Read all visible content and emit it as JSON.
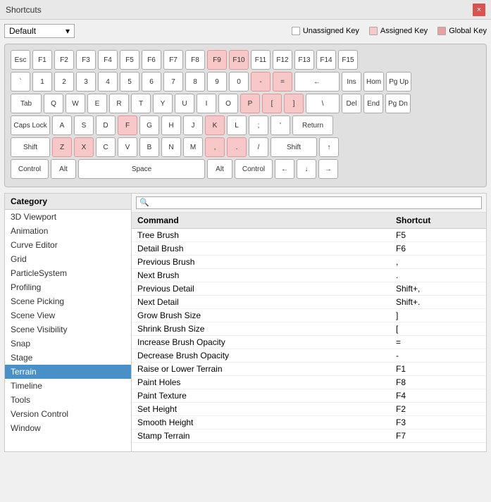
{
  "titleBar": {
    "title": "Shortcuts",
    "closeLabel": "×"
  },
  "toolbar": {
    "dropdownValue": "Default",
    "dropdownArrow": "▾",
    "legend": [
      {
        "id": "unassigned",
        "label": "Unassigned Key",
        "color": "white"
      },
      {
        "id": "assigned",
        "label": "Assigned Key",
        "color": "#f8c8c8"
      },
      {
        "id": "global",
        "label": "Global Key",
        "color": "#e8a0a0"
      }
    ]
  },
  "keyboard": {
    "rows": [
      {
        "keys": [
          {
            "label": "Esc",
            "class": "",
            "assigned": false
          },
          {
            "label": "F1",
            "class": "",
            "assigned": false
          },
          {
            "label": "F2",
            "class": "",
            "assigned": false
          },
          {
            "label": "F3",
            "class": "",
            "assigned": false
          },
          {
            "label": "F4",
            "class": "",
            "assigned": false
          },
          {
            "label": "F5",
            "class": "",
            "assigned": false
          },
          {
            "label": "F6",
            "class": "",
            "assigned": false
          },
          {
            "label": "F7",
            "class": "",
            "assigned": false
          },
          {
            "label": "F8",
            "class": "",
            "assigned": false
          },
          {
            "label": "F9",
            "class": "assigned",
            "assigned": true
          },
          {
            "label": "F10",
            "class": "assigned",
            "assigned": true
          },
          {
            "label": "F11",
            "class": "",
            "assigned": false
          },
          {
            "label": "F12",
            "class": "",
            "assigned": false
          },
          {
            "label": "F13",
            "class": "",
            "assigned": false
          },
          {
            "label": "F14",
            "class": "",
            "assigned": false
          },
          {
            "label": "F15",
            "class": "",
            "assigned": false
          }
        ]
      },
      {
        "keys": [
          {
            "label": "`",
            "class": "",
            "assigned": false
          },
          {
            "label": "1",
            "class": "",
            "assigned": false
          },
          {
            "label": "2",
            "class": "",
            "assigned": false
          },
          {
            "label": "3",
            "class": "",
            "assigned": false
          },
          {
            "label": "4",
            "class": "",
            "assigned": false
          },
          {
            "label": "5",
            "class": "",
            "assigned": false
          },
          {
            "label": "6",
            "class": "",
            "assigned": false
          },
          {
            "label": "7",
            "class": "",
            "assigned": false
          },
          {
            "label": "8",
            "class": "",
            "assigned": false
          },
          {
            "label": "9",
            "class": "",
            "assigned": false
          },
          {
            "label": "0",
            "class": "",
            "assigned": false
          },
          {
            "label": "-",
            "class": "assigned",
            "assigned": true
          },
          {
            "label": "=",
            "class": "assigned",
            "assigned": true
          },
          {
            "label": "←",
            "class": "backspace",
            "assigned": false
          },
          {
            "label": "Ins",
            "class": "",
            "assigned": false
          },
          {
            "label": "Hom",
            "class": "",
            "assigned": false
          },
          {
            "label": "Pg Up",
            "class": "",
            "assigned": false
          }
        ]
      },
      {
        "keys": [
          {
            "label": "Tab",
            "class": "tab",
            "assigned": false
          },
          {
            "label": "Q",
            "class": "",
            "assigned": false
          },
          {
            "label": "W",
            "class": "",
            "assigned": false
          },
          {
            "label": "E",
            "class": "",
            "assigned": false
          },
          {
            "label": "R",
            "class": "",
            "assigned": false
          },
          {
            "label": "T",
            "class": "",
            "assigned": false
          },
          {
            "label": "Y",
            "class": "",
            "assigned": false
          },
          {
            "label": "U",
            "class": "",
            "assigned": false
          },
          {
            "label": "I",
            "class": "",
            "assigned": false
          },
          {
            "label": "O",
            "class": "",
            "assigned": false
          },
          {
            "label": "P",
            "class": "assigned",
            "assigned": true
          },
          {
            "label": "[",
            "class": "assigned",
            "assigned": true
          },
          {
            "label": "]",
            "class": "assigned",
            "assigned": true
          },
          {
            "label": "\\",
            "class": "wide",
            "assigned": false
          },
          {
            "label": "Del",
            "class": "",
            "assigned": false
          },
          {
            "label": "End",
            "class": "",
            "assigned": false
          },
          {
            "label": "Pg Dn",
            "class": "",
            "assigned": false
          }
        ]
      },
      {
        "keys": [
          {
            "label": "Caps Lock",
            "class": "capslock",
            "assigned": false
          },
          {
            "label": "A",
            "class": "",
            "assigned": false
          },
          {
            "label": "S",
            "class": "",
            "assigned": false
          },
          {
            "label": "D",
            "class": "",
            "assigned": false
          },
          {
            "label": "F",
            "class": "assigned",
            "assigned": true
          },
          {
            "label": "G",
            "class": "",
            "assigned": false
          },
          {
            "label": "H",
            "class": "",
            "assigned": false
          },
          {
            "label": "J",
            "class": "",
            "assigned": false
          },
          {
            "label": "K",
            "class": "assigned",
            "assigned": true
          },
          {
            "label": "L",
            "class": "",
            "assigned": false
          },
          {
            "label": ";",
            "class": "",
            "assigned": false
          },
          {
            "label": "'",
            "class": "",
            "assigned": false
          },
          {
            "label": "Return",
            "class": "enter",
            "assigned": false
          }
        ]
      },
      {
        "keys": [
          {
            "label": "Shift",
            "class": "shift-l",
            "assigned": false
          },
          {
            "label": "Z",
            "class": "assigned",
            "assigned": true
          },
          {
            "label": "X",
            "class": "assigned",
            "assigned": true
          },
          {
            "label": "C",
            "class": "",
            "assigned": false
          },
          {
            "label": "V",
            "class": "",
            "assigned": false
          },
          {
            "label": "B",
            "class": "",
            "assigned": false
          },
          {
            "label": "N",
            "class": "",
            "assigned": false
          },
          {
            "label": "M",
            "class": "",
            "assigned": false
          },
          {
            "label": ",",
            "class": "assigned",
            "assigned": true
          },
          {
            "label": ".",
            "class": "assigned",
            "assigned": true
          },
          {
            "label": "/",
            "class": "",
            "assigned": false
          },
          {
            "label": "Shift",
            "class": "shift-r",
            "assigned": false
          },
          {
            "label": "↑",
            "class": "",
            "assigned": false
          }
        ]
      },
      {
        "keys": [
          {
            "label": "Control",
            "class": "ctrl",
            "assigned": false
          },
          {
            "label": "Alt",
            "class": "alt",
            "assigned": false
          },
          {
            "label": "Space",
            "class": "space",
            "assigned": false
          },
          {
            "label": "Alt",
            "class": "alt",
            "assigned": false
          },
          {
            "label": "Control",
            "class": "ctrl",
            "assigned": false
          },
          {
            "label": "←",
            "class": "",
            "assigned": false
          },
          {
            "label": "↓",
            "class": "",
            "assigned": false
          },
          {
            "label": "→",
            "class": "",
            "assigned": false
          }
        ]
      }
    ]
  },
  "search": {
    "placeholder": "🔍"
  },
  "categories": {
    "header": "Category",
    "items": [
      {
        "label": "3D Viewport",
        "selected": false
      },
      {
        "label": "Animation",
        "selected": false
      },
      {
        "label": "Curve Editor",
        "selected": false
      },
      {
        "label": "Grid",
        "selected": false
      },
      {
        "label": "ParticleSystem",
        "selected": false
      },
      {
        "label": "Profiling",
        "selected": false
      },
      {
        "label": "Scene Picking",
        "selected": false
      },
      {
        "label": "Scene View",
        "selected": false
      },
      {
        "label": "Scene Visibility",
        "selected": false
      },
      {
        "label": "Snap",
        "selected": false
      },
      {
        "label": "Stage",
        "selected": false
      },
      {
        "label": "Terrain",
        "selected": true
      },
      {
        "label": "Timeline",
        "selected": false
      },
      {
        "label": "Tools",
        "selected": false
      },
      {
        "label": "Version Control",
        "selected": false
      },
      {
        "label": "Window",
        "selected": false
      }
    ]
  },
  "commands": {
    "header": {
      "command": "Command",
      "shortcut": "Shortcut"
    },
    "items": [
      {
        "command": "Tree Brush",
        "shortcut": "F5"
      },
      {
        "command": "Detail Brush",
        "shortcut": "F6"
      },
      {
        "command": "Previous Brush",
        "shortcut": ","
      },
      {
        "command": "Next Brush",
        "shortcut": "."
      },
      {
        "command": "Previous Detail",
        "shortcut": "Shift+,"
      },
      {
        "command": "Next Detail",
        "shortcut": "Shift+."
      },
      {
        "command": "Grow Brush Size",
        "shortcut": "]"
      },
      {
        "command": "Shrink Brush Size",
        "shortcut": "["
      },
      {
        "command": "Increase Brush Opacity",
        "shortcut": "="
      },
      {
        "command": "Decrease Brush Opacity",
        "shortcut": "-"
      },
      {
        "command": "Raise or Lower Terrain",
        "shortcut": "F1"
      },
      {
        "command": "Paint Holes",
        "shortcut": "F8"
      },
      {
        "command": "Paint Texture",
        "shortcut": "F4"
      },
      {
        "command": "Set Height",
        "shortcut": "F2"
      },
      {
        "command": "Smooth Height",
        "shortcut": "F3"
      },
      {
        "command": "Stamp Terrain",
        "shortcut": "F7"
      }
    ]
  }
}
